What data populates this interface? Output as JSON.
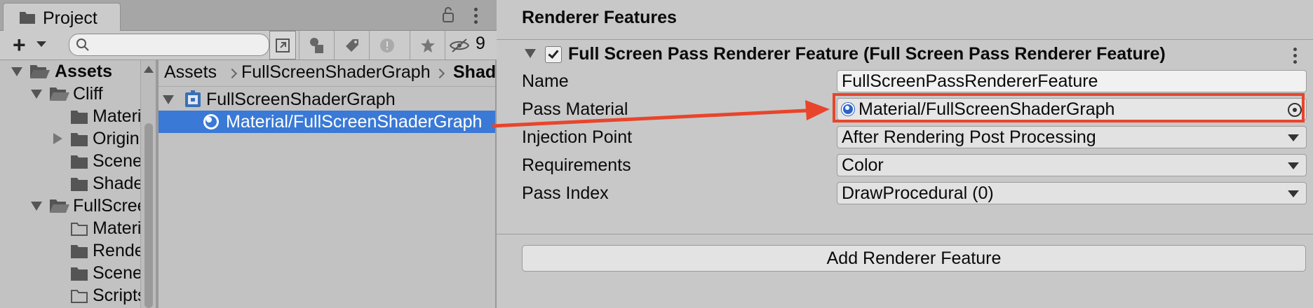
{
  "project_window": {
    "tab_label": "Project",
    "search": {
      "value": "",
      "placeholder": ""
    },
    "hidden_count": "9",
    "tree": [
      {
        "label": "Assets",
        "bold": true
      },
      {
        "label": "Cliff"
      },
      {
        "label": "Materials"
      },
      {
        "label": "Origin"
      },
      {
        "label": "Scenes"
      },
      {
        "label": "Shaders"
      },
      {
        "label": "FullScreen"
      },
      {
        "label": "Materials"
      },
      {
        "label": "Renderers"
      },
      {
        "label": "Scenes"
      },
      {
        "label": "Scripts"
      }
    ],
    "breadcrumb": [
      "Assets",
      "FullScreenShaderGraph",
      "Shad"
    ],
    "assets": [
      {
        "label": "FullScreenShaderGraph"
      },
      {
        "label": "Material/FullScreenShaderGraph",
        "selected": true
      }
    ]
  },
  "inspector": {
    "section_title": "Renderer Features",
    "feature": {
      "title": "Full Screen Pass Renderer Feature (Full Screen Pass Renderer Feature)",
      "enabled": true
    },
    "properties": {
      "name": {
        "label": "Name",
        "value": "FullScreenPassRendererFeature"
      },
      "pass_material": {
        "label": "Pass Material",
        "value": "Material/FullScreenShaderGraph"
      },
      "injection_point": {
        "label": "Injection Point",
        "value": "After Rendering Post Processing"
      },
      "requirements": {
        "label": "Requirements",
        "value": "Color"
      },
      "pass_index": {
        "label": "Pass Index",
        "value": "DrawProcedural (0)"
      }
    },
    "add_button": "Add Renderer Feature"
  },
  "annotation": {
    "color": "#e8452c"
  },
  "colors": {
    "selection": "#3a79d6",
    "object_icon": "#2a63c9"
  },
  "icons": [
    "folder-icon",
    "lock-icon",
    "kebab-menu-icon",
    "plus-icon",
    "search-icon",
    "shader-graph-icon",
    "material-icon",
    "object-picker-icon"
  ]
}
